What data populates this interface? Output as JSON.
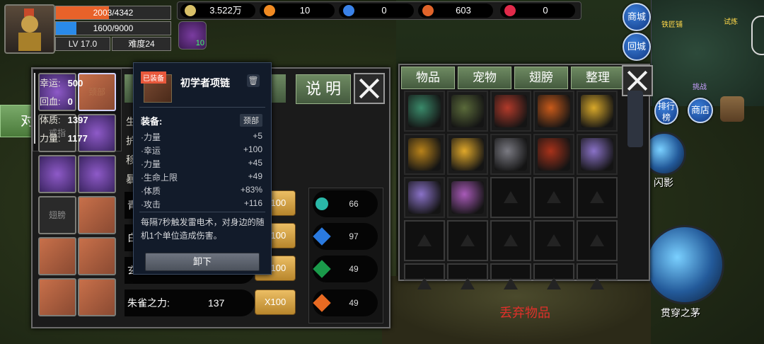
{
  "player": {
    "hp": "2003/4342",
    "hp_fraction": 0.461,
    "mp": "1600/9000",
    "mp_fraction": 0.178,
    "level": "LV  17.0",
    "difficulty": "难度24"
  },
  "resources": [
    {
      "icon": "coin-icon",
      "value": "3.522万",
      "color": "#d8c068"
    },
    {
      "icon": "fire-crystal-icon",
      "value": "10",
      "color": "#f08a22"
    },
    {
      "icon": "blue-feather-icon",
      "value": "0",
      "color": "#3a82e8"
    },
    {
      "icon": "orange-gem-icon",
      "value": "603",
      "color": "#e0642a"
    },
    {
      "icon": "heart-icon",
      "value": "0",
      "color": "#e02a4a"
    }
  ],
  "buff": {
    "value": "10"
  },
  "top_right": {
    "shop_mall": "商城",
    "return_city": "回城"
  },
  "minimap": {
    "loc1": "铁匠铺",
    "loc2": "试炼",
    "loc3": "挑战"
  },
  "side_buttons": {
    "ranking": "排行榜",
    "store": "商店"
  },
  "skills": {
    "flash": "闪影",
    "pierce": "贯穿之茅"
  },
  "fight_tab": "对",
  "equip_panel": {
    "explain_label": "说 明",
    "slots": [
      {
        "label": "",
        "kind": "purple"
      },
      {
        "label": "颈部",
        "kind": "orange"
      },
      {
        "label": "戒指",
        "kind": "empty"
      },
      {
        "label": "",
        "kind": "purple"
      },
      {
        "label": "",
        "kind": "purple"
      },
      {
        "label": "",
        "kind": "purple"
      },
      {
        "label": "翅膀",
        "kind": "empty"
      },
      {
        "label": "",
        "kind": "orange"
      },
      {
        "label": "",
        "kind": "orange"
      },
      {
        "label": "",
        "kind": "orange"
      },
      {
        "label": "",
        "kind": "orange"
      },
      {
        "label": "",
        "kind": "orange"
      }
    ],
    "stats": [
      {
        "name": "幸运:",
        "value": "500"
      },
      {
        "name": "回血:",
        "value": "0"
      },
      {
        "name": "体质:",
        "value": "1397"
      },
      {
        "name": "力量:",
        "value": "1177"
      }
    ],
    "hidden_stat_initials": [
      "生",
      "护",
      "移",
      "暴"
    ],
    "skill_rows": [
      {
        "name": "青",
        "value": ""
      },
      {
        "name": "白",
        "value": ""
      },
      {
        "name": "玄",
        "value": ""
      },
      {
        "name": "朱雀之力:",
        "value": "137"
      }
    ],
    "upgrade_label": "X100",
    "stones": [
      {
        "count": "66",
        "color": "#2ab8a8"
      },
      {
        "count": "97",
        "color": "#2a7ae0"
      },
      {
        "count": "49",
        "color": "#1a9a4a"
      },
      {
        "count": "49",
        "color": "#e86a22"
      }
    ]
  },
  "tooltip": {
    "equipped_tag": "已装备",
    "name": "初学者项链",
    "trash": "🗑",
    "section": "装备:",
    "slot": "颈部",
    "attrs": [
      {
        "name": "·力量",
        "value": "+5"
      },
      {
        "name": "·幸运",
        "value": "+100"
      },
      {
        "name": "·力量",
        "value": "+45"
      },
      {
        "name": "·生命上限",
        "value": "+49"
      },
      {
        "name": "·体质",
        "value": "+83%"
      },
      {
        "name": "·攻击",
        "value": "+116"
      }
    ],
    "description": "每隔7秒触发雷电术，对身边的随机1个单位造成伤害。",
    "unequip_label": "卸下"
  },
  "inventory": {
    "tabs": [
      "物品",
      "宠物",
      "翅膀",
      "整理"
    ],
    "items": [
      {
        "name": "jade-armor-icon",
        "color": "#3a8a6a"
      },
      {
        "name": "green-hood-icon",
        "color": "#5a6a3a"
      },
      {
        "name": "fire-claw-icon",
        "color": "#b23a2a"
      },
      {
        "name": "flame-sword-icon",
        "color": "#c85a1a"
      },
      {
        "name": "gold-boots-icon",
        "color": "#d8a82a"
      },
      {
        "name": "gold-helmet-icon",
        "color": "#b8821a"
      },
      {
        "name": "gold-ring-icon",
        "color": "#e0a82a"
      },
      {
        "name": "iron-helmet-icon",
        "color": "#7a7a82"
      },
      {
        "name": "red-helmet-icon",
        "color": "#a8321a"
      },
      {
        "name": "violet-boots-icon",
        "color": "#8a72c8"
      },
      {
        "name": "violet-boots-icon",
        "color": "#8a72c8"
      },
      {
        "name": "purple-bracer-icon",
        "color": "#a85ab8"
      }
    ],
    "discard_label": "丢弃物品"
  }
}
